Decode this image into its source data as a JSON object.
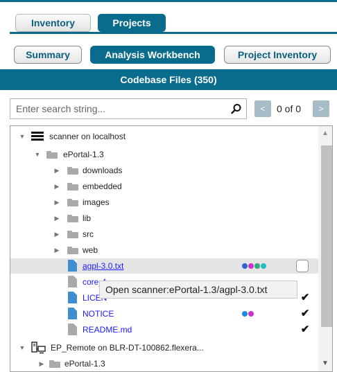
{
  "tabs_primary": [
    {
      "label": "Inventory",
      "active": false
    },
    {
      "label": "Projects",
      "active": true
    }
  ],
  "tabs_secondary": [
    {
      "label": "Summary",
      "active": false
    },
    {
      "label": "Analysis Workbench",
      "active": true
    },
    {
      "label": "Project Inventory",
      "active": false
    }
  ],
  "section_header": "Codebase Files (350)",
  "search": {
    "placeholder": "Enter search string...",
    "value": "",
    "counter": "0 of 0",
    "prev_glyph": "<",
    "next_glyph": ">"
  },
  "tree": {
    "server": {
      "label": "scanner on localhost",
      "icon": "server-icon"
    },
    "project": {
      "label": "ePortal-1.3",
      "icon": "folder-icon"
    },
    "folders": [
      "downloads",
      "embedded",
      "images",
      "lib",
      "src",
      "web"
    ],
    "files": [
      {
        "label": "agpl-3.0.txt",
        "file_color": "blue",
        "style": "link-underline",
        "selected": true,
        "dots": [
          "#3366cc",
          "#cc33cc",
          "#33aa77",
          "#22bbcc"
        ],
        "status": "unchecked"
      },
      {
        "label": "core_f",
        "file_color": "gray",
        "style": "link",
        "selected": false,
        "dots": [],
        "status": ""
      },
      {
        "label": "LICEN",
        "file_color": "blue",
        "style": "link",
        "selected": false,
        "dots": [],
        "status": "check"
      },
      {
        "label": "NOTICE",
        "file_color": "blue",
        "style": "link",
        "selected": false,
        "dots": [
          "#1e88e5",
          "#cc33cc"
        ],
        "status": "check"
      },
      {
        "label": "README.md",
        "file_color": "gray",
        "style": "link",
        "selected": false,
        "dots": [],
        "status": "check"
      }
    ],
    "remote": {
      "label": "EP_Remote on BLR-DT-100862.flexera...",
      "icon": "remote-computer-icon"
    },
    "remote_child": {
      "label": "ePortal-1.3",
      "icon": "folder-icon"
    },
    "check_glyph": "✔"
  },
  "tooltip": "Open scanner:ePortal-1.3/agpl-3.0.txt",
  "colors": {
    "accent": "#0a6c8c",
    "link": "#1a1aff"
  }
}
